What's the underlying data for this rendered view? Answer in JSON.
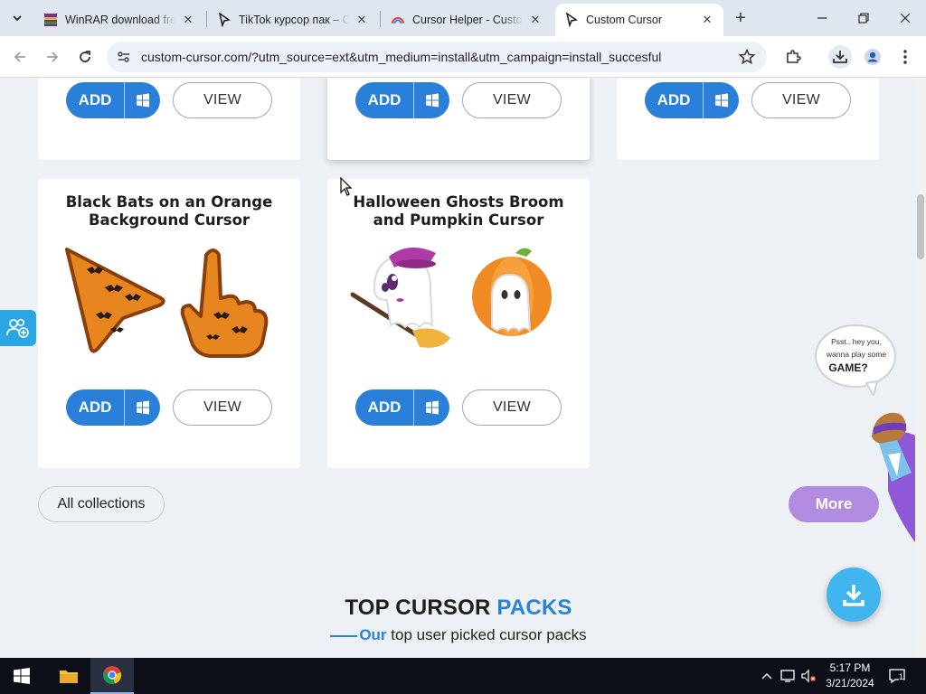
{
  "browser": {
    "tabs": [
      {
        "title": "WinRAR download free",
        "icon": "winrar-icon"
      },
      {
        "title": "TikTok курсор пак – Cu",
        "icon": "cursor-arrow-icon"
      },
      {
        "title": "Cursor Helper - Custom",
        "icon": "rainbow-icon"
      },
      {
        "title": "Custom Cursor",
        "icon": "cursor-arrow-icon",
        "active": true
      }
    ],
    "new_tab_label": "+",
    "url": "custom-cursor.com/?utm_source=ext&utm_medium=install&utm_campaign=install_succesful"
  },
  "cards_top": [
    {
      "add_label": "ADD",
      "view_label": "VIEW"
    },
    {
      "add_label": "ADD",
      "view_label": "VIEW"
    },
    {
      "add_label": "ADD",
      "view_label": "VIEW"
    }
  ],
  "cards": [
    {
      "title": "Black Bats on an Orange Background Cursor",
      "add_label": "ADD",
      "view_label": "VIEW"
    },
    {
      "title": "Halloween Ghosts Broom and Pumpkin Cursor",
      "add_label": "ADD",
      "view_label": "VIEW"
    }
  ],
  "buttons": {
    "all_collections": "All collections",
    "more": "More"
  },
  "section": {
    "title_main": "TOP CURSOR ",
    "title_accent": "PACKS",
    "subtitle_accent": "Our",
    "subtitle_rest": " top user picked cursor packs"
  },
  "promo": {
    "bubble_line1": "Psst.. hey you,",
    "bubble_line2": "wanna play some",
    "bubble_line3": "GAME?"
  },
  "taskbar": {
    "time": "5:17 PM",
    "date": "3/21/2024",
    "notification_count": "1"
  },
  "colors": {
    "accent_blue": "#2a7fd9",
    "more_purple": "#b08be0",
    "page_bg": "#edf1f5"
  }
}
